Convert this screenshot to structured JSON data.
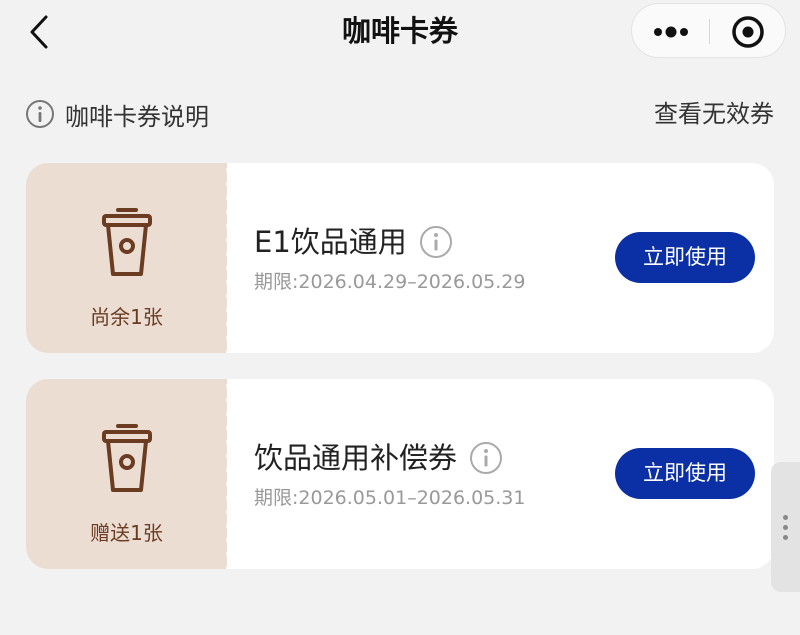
{
  "header": {
    "title": "咖啡卡券"
  },
  "subheader": {
    "info_label": "咖啡卡券说明",
    "invalid_label": "查看无效券"
  },
  "coupons": [
    {
      "stub_text": "尚余1张",
      "title": "E1饮品通用",
      "period": "期限:2026.04.29–2026.05.29",
      "button_label": "立即使用"
    },
    {
      "stub_text": "赠送1张",
      "title": "饮品通用补偿券",
      "period": "期限:2026.05.01–2026.05.31",
      "button_label": "立即使用"
    }
  ],
  "colors": {
    "page_bg": "#f2f2f2",
    "stub_bg": "#ecddd3",
    "stub_text": "#6b3c22",
    "primary_button": "#0b2fa4"
  },
  "icons": [
    "back-arrow-icon",
    "more-dots-icon",
    "close-target-icon",
    "info-icon",
    "coffee-cup-icon"
  ]
}
